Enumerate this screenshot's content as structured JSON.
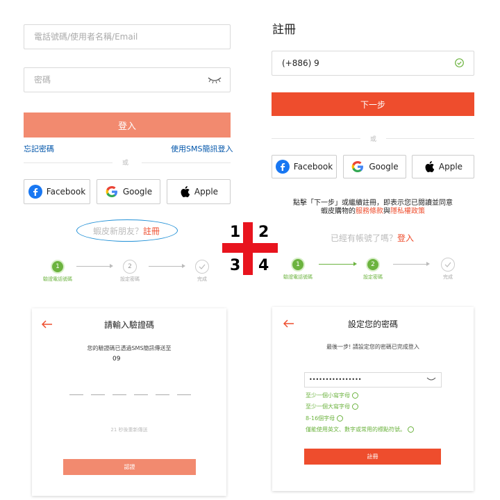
{
  "login": {
    "account_placeholder": "電話號碼/使用者名稱/Email",
    "password_placeholder": "密碼",
    "login_button": "登入",
    "forgot_password": "忘記密碼",
    "sms_login": "使用SMS簡訊登入",
    "or": "或",
    "signup_prompt": "蝦皮新朋友？",
    "signup_link": "註冊"
  },
  "social": {
    "facebook": "Facebook",
    "google": "Google",
    "apple": "Apple"
  },
  "register": {
    "title": "註冊",
    "phone_value": "(+886) 9",
    "next_button": "下一步",
    "or": "或",
    "terms_line1": "點擊「下一步」或繼續註冊，即表示您已閱讀並同意",
    "terms_line2_prefix": "蝦皮購物的",
    "terms_link": "服務條款",
    "terms_and": "與",
    "privacy_link": "隱私權政策",
    "has_account": "已經有帳號了嗎？",
    "login_link": "登入"
  },
  "steps": {
    "step1_label": "驗證電話號碼",
    "step2_label": "設定密碼",
    "step3_label": "完成",
    "n1": "1",
    "n2": "2"
  },
  "overlay": {
    "q1": "1",
    "q2": "2",
    "q3": "3",
    "q4": "4"
  },
  "verify": {
    "title": "請輸入驗證碼",
    "sent_text": "您的驗證碼已透過SMS簡訊傳送至",
    "phone": "09",
    "resend": "21 秒後重新傳送",
    "confirm_button": "認證"
  },
  "setpw": {
    "title": "設定您的密碼",
    "subtitle": "最後一步! 請設定您的密碼已完成登入",
    "password_value": "••••••••••••••••",
    "rule1": "至少一個小寫字母",
    "rule2": "至少一個大寫字母",
    "rule3": "8-16個字母",
    "rule4": "僅能使用英文、數字或常用的標點符號。",
    "signup_button": "註冊"
  },
  "colors": {
    "primary": "#ee4d2d",
    "primary_light": "#f28a6f",
    "success": "#6cb33f",
    "link_blue": "#0055aa",
    "cross_red": "#e8141e"
  }
}
